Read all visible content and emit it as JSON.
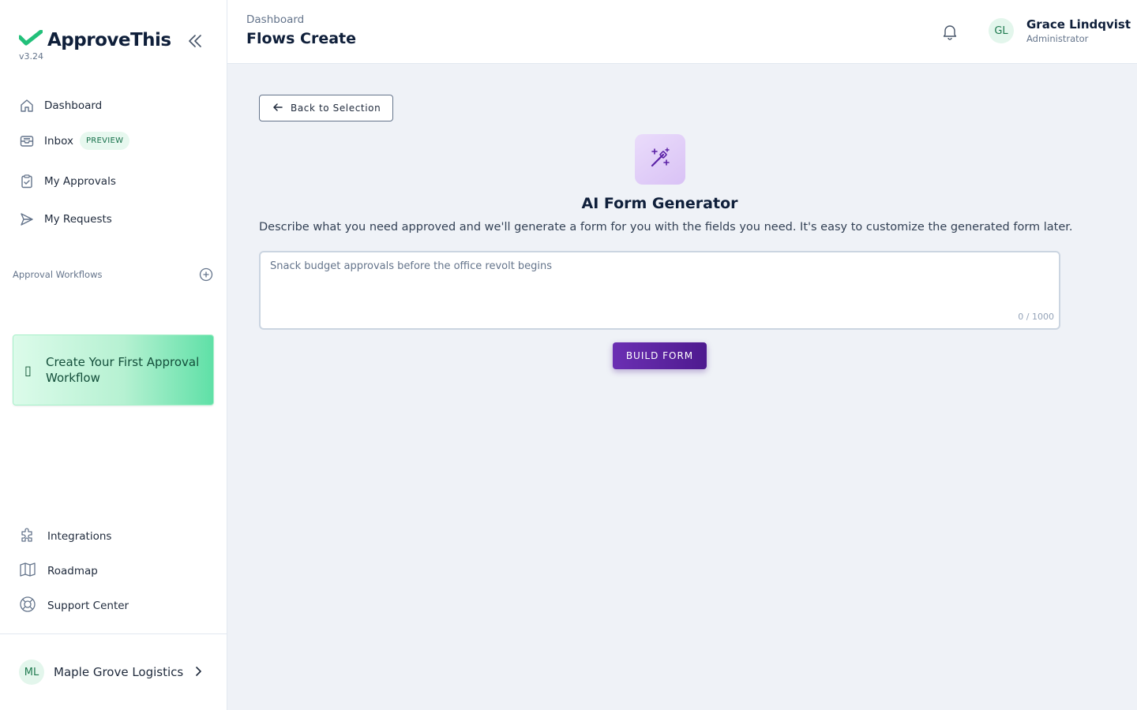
{
  "app": {
    "brand_name": "ApproveThis",
    "version": "v3.24"
  },
  "sidebar": {
    "nav": [
      {
        "label": "Dashboard",
        "icon": "home-icon"
      },
      {
        "label": "Inbox",
        "icon": "inbox-icon",
        "badge": "PREVIEW"
      },
      {
        "label": "My Approvals",
        "icon": "clipboard-check-icon"
      },
      {
        "label": "My Requests",
        "icon": "send-icon"
      }
    ],
    "section_title": "Approval Workflows",
    "cta_label": "Create Your First Approval Workflow",
    "cta_icon_glyph": "▯",
    "bottom_links": [
      {
        "label": "Integrations",
        "icon": "puzzle-icon"
      },
      {
        "label": "Roadmap",
        "icon": "map-icon"
      },
      {
        "label": "Support Center",
        "icon": "lifebuoy-icon"
      }
    ],
    "org": {
      "initials": "ML",
      "name": "Maple Grove Logistics"
    }
  },
  "header": {
    "breadcrumb": "Dashboard",
    "title": "Flows Create",
    "user": {
      "initials": "GL",
      "name": "Grace Lindqvist",
      "role": "Administrator"
    }
  },
  "main": {
    "back_label": "Back to Selection",
    "generator_title": "AI Form Generator",
    "generator_desc": "Describe what you need approved and we'll generate a form for you with the fields you need. It's easy to customize the generated form later.",
    "prompt": {
      "value": "",
      "placeholder": "Snack budget approvals before the office revolt begins",
      "counter": "0 / 1000"
    },
    "build_label": "BUILD FORM"
  },
  "colors": {
    "brand_green": "#22c07a",
    "accent_purple": "#5b21a6",
    "background": "#eff2f7"
  }
}
